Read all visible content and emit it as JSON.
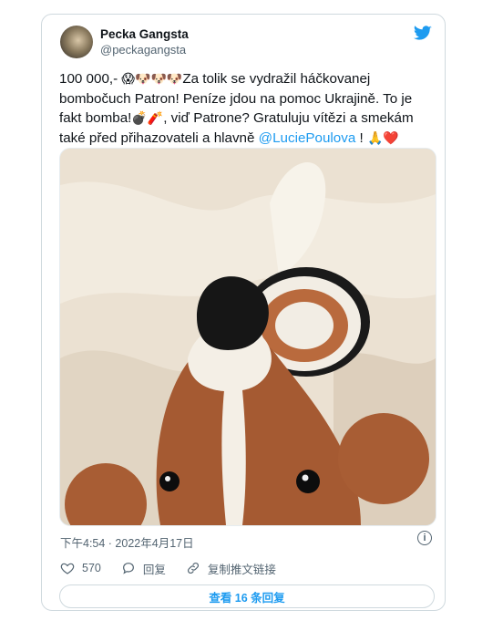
{
  "user": {
    "display_name": "Pecka Gangsta",
    "handle": "@peckagangsta"
  },
  "tweet": {
    "amount": "100 000,-",
    "emoji_group_1": "😱🐶🐶🐶",
    "text_1": "Za tolik se vydražil háčkovanej bombočuch Patron! Peníze jdou na pomoc Ukrajině. To je fakt bomba!",
    "emoji_group_2": "💣🧨",
    "text_2": ", viď Patrone? Gratuluju vítězi a smekám také před přihazovateli a hlavně ",
    "mention": "@LuciePoulova",
    "text_3": " !",
    "emoji_group_3": "🙏❤️"
  },
  "meta": {
    "timestamp": "下午4:54 · 2022年4月17日",
    "info_symbol": "i"
  },
  "actions": {
    "likes": "570",
    "reply_label": "回复",
    "copy_link_label": "复制推文链接"
  },
  "replies_button": "查看 16 条回复",
  "colors": {
    "accent": "#1d9bf0",
    "like_red": "#f91880"
  },
  "icons": [
    "twitter-bird-icon",
    "info-icon",
    "heart-icon",
    "reply-icon",
    "link-icon"
  ]
}
